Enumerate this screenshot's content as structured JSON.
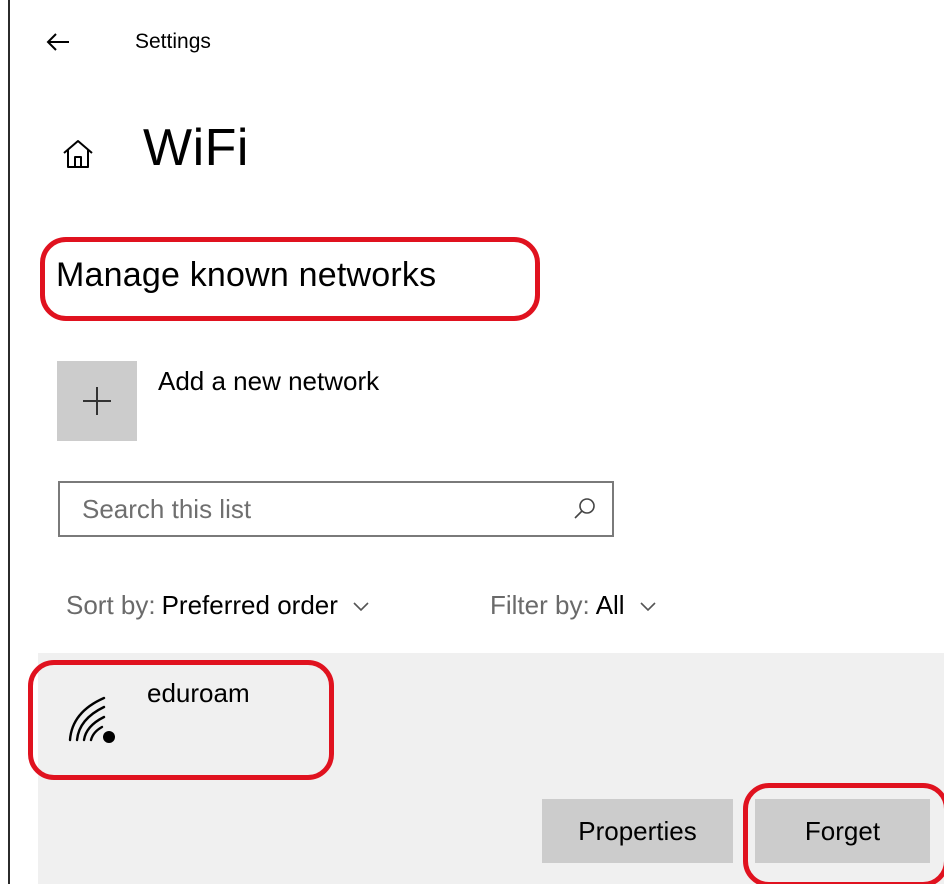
{
  "header": {
    "app_title": "Settings",
    "back_icon": "arrow-left-icon"
  },
  "page": {
    "home_icon": "home-icon",
    "title": "WiFi"
  },
  "section": {
    "title": "Manage known networks"
  },
  "add_network": {
    "icon": "plus-icon",
    "label": "Add a new network"
  },
  "search": {
    "placeholder": "Search this list",
    "value": "",
    "icon": "search-icon"
  },
  "sort": {
    "label": "Sort by:",
    "value": "Preferred order"
  },
  "filter": {
    "label": "Filter by:",
    "value": "All"
  },
  "networks": [
    {
      "name": "eduroam",
      "icon": "wifi-secured-icon",
      "actions": {
        "properties_label": "Properties",
        "forget_label": "Forget"
      }
    }
  ],
  "annotations": {
    "highlight_color": "#e0121f"
  },
  "colors": {
    "tile_gray": "#cccccc",
    "panel_gray": "#f0f0f0",
    "text_muted": "#6a6a6a"
  }
}
